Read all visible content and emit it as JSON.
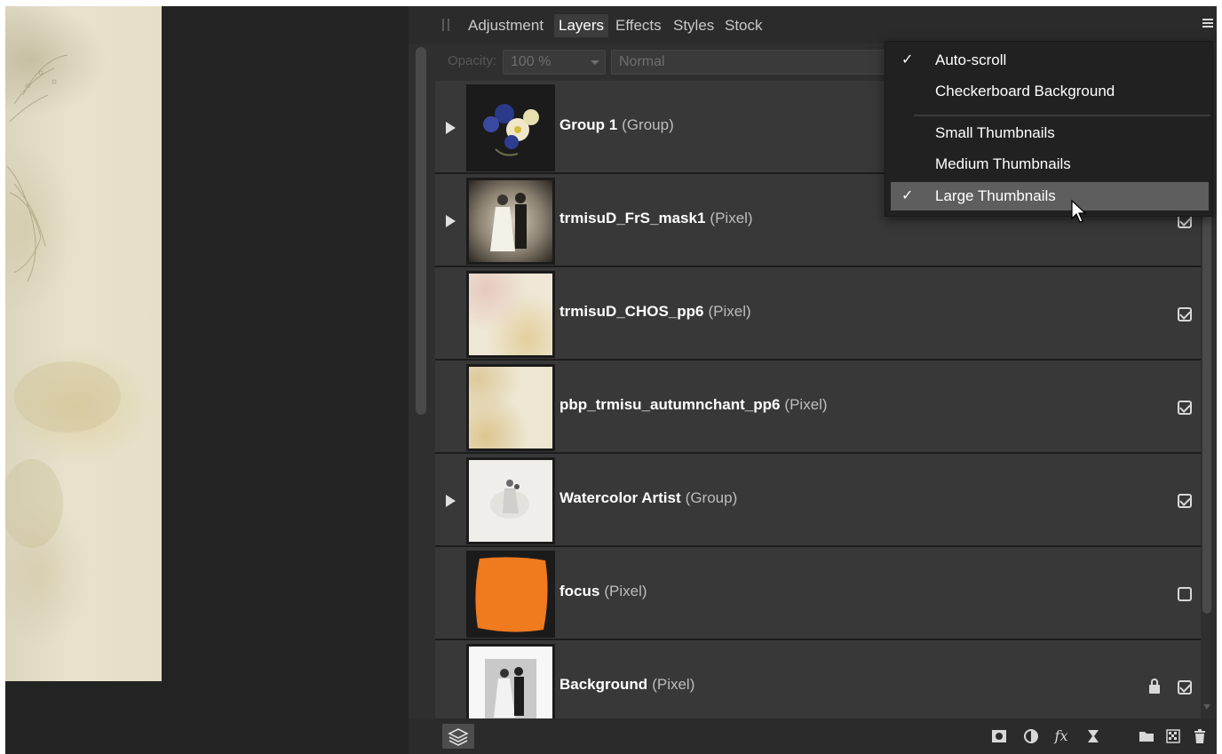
{
  "panel": {
    "tabs": [
      "Adjustment",
      "Layers",
      "Effects",
      "Styles",
      "Stock"
    ],
    "active_tab": "Layers",
    "opacity_label": "Opacity:",
    "opacity_value": "100 %",
    "blend_mode": "Normal"
  },
  "layers": [
    {
      "name": "Group 1",
      "type": "(Group)",
      "expandable": true,
      "visible": true,
      "locked": false,
      "thumb": "flowers"
    },
    {
      "name": "trmisuD_FrS_mask1",
      "type": "(Pixel)",
      "expandable": true,
      "visible": true,
      "locked": false,
      "thumb": "couple-dark"
    },
    {
      "name": "trmisuD_CHOS_pp6",
      "type": "(Pixel)",
      "expandable": false,
      "visible": true,
      "locked": false,
      "thumb": "paper-pink"
    },
    {
      "name": "pbp_trmisu_autumnchant_pp6",
      "type": "(Pixel)",
      "expandable": false,
      "visible": true,
      "locked": false,
      "thumb": "paper-cream"
    },
    {
      "name": "Watercolor Artist",
      "type": "(Group)",
      "expandable": true,
      "visible": true,
      "locked": false,
      "thumb": "watercolor"
    },
    {
      "name": "focus",
      "type": "(Pixel)",
      "expandable": false,
      "visible": false,
      "locked": false,
      "thumb": "orange"
    },
    {
      "name": "Background",
      "type": "(Pixel)",
      "expandable": false,
      "visible": true,
      "locked": true,
      "thumb": "couple-photo"
    }
  ],
  "menu": {
    "items": [
      {
        "label": "Auto-scroll",
        "checked": true
      },
      {
        "label": "Checkerboard Background",
        "checked": false
      },
      {
        "label": "Small Thumbnails",
        "checked": false
      },
      {
        "label": "Medium Thumbnails",
        "checked": false
      },
      {
        "label": "Large Thumbnails",
        "checked": true,
        "hover": true
      }
    ]
  },
  "bottom_icons": [
    "mask-icon",
    "adjustment-icon",
    "fx-icon",
    "live-filter-icon",
    "group-folder-icon",
    "pixel-layer-icon",
    "trash-icon"
  ],
  "colors": {
    "menu_bg": "#212121",
    "menu_hover": "#5e5e5e",
    "panel_bg": "#2f2f2f",
    "row_bg": "#383838"
  }
}
